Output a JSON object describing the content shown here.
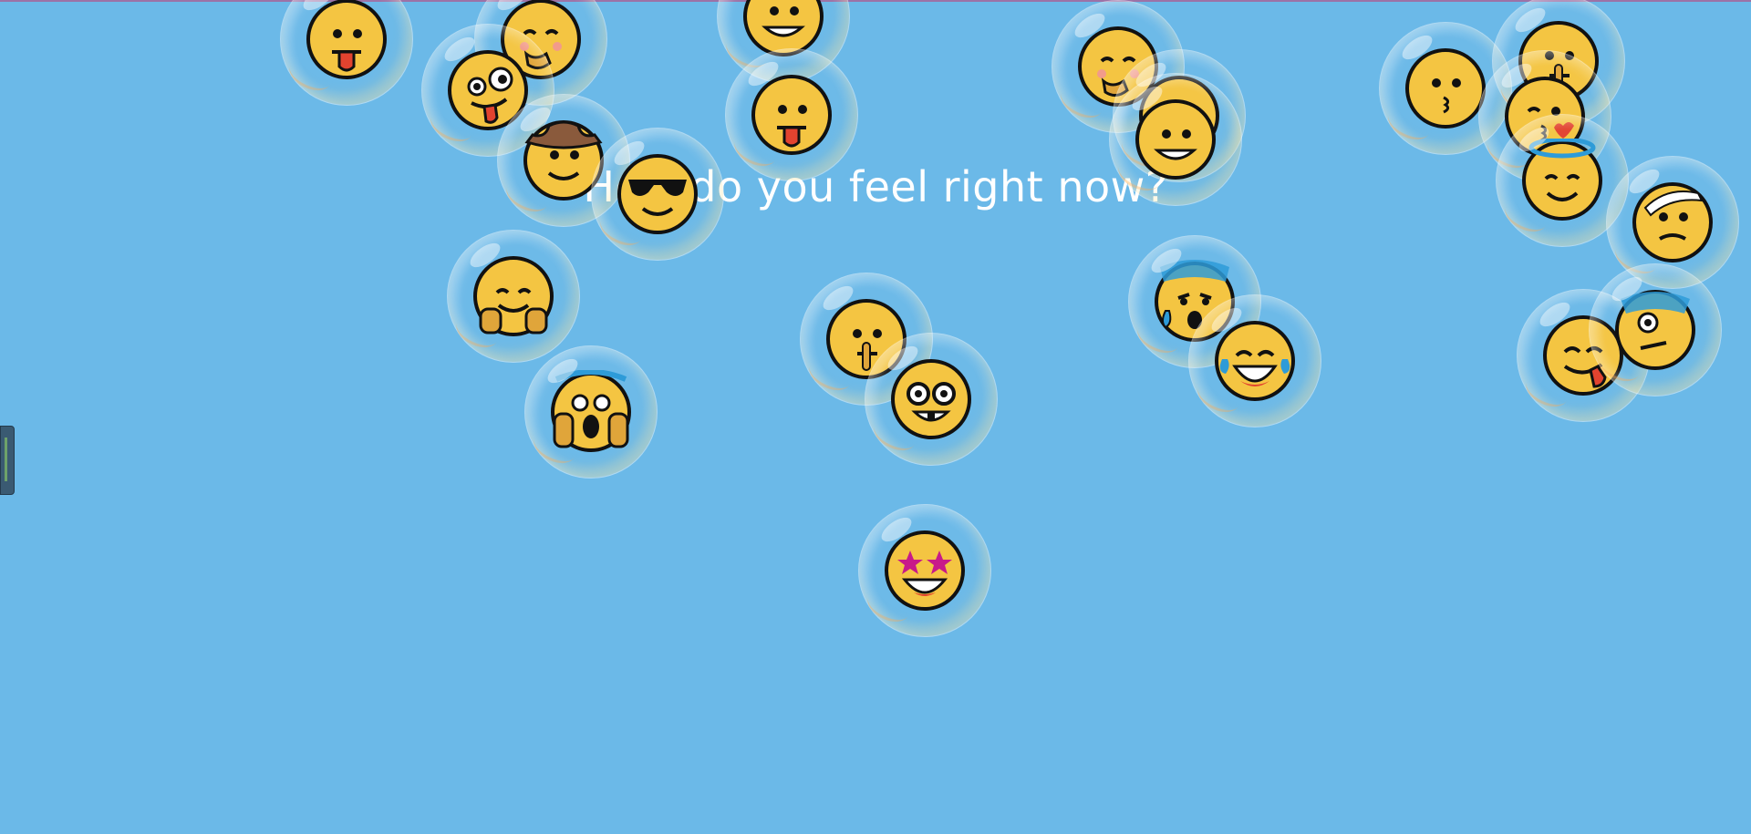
{
  "prompt": {
    "text": "How do you feel right now?"
  },
  "colors": {
    "background": "#6bb9e8",
    "face": "#f4c542",
    "outline": "#111111",
    "tongue": "#e2432f",
    "tear": "#2e9bd8",
    "star": "#c8198a"
  },
  "emojis": [
    {
      "name": "tongue-face-emoji",
      "kind": "tongue"
    },
    {
      "name": "hand-over-mouth-emoji",
      "kind": "hand"
    },
    {
      "name": "grinning-face-emoji",
      "kind": "grin"
    },
    {
      "name": "zany-face-emoji",
      "kind": "zany"
    },
    {
      "name": "tongue-out-face-emoji",
      "kind": "tongue"
    },
    {
      "name": "cowboy-face-emoji",
      "kind": "cowboy"
    },
    {
      "name": "sunglasses-face-emoji",
      "kind": "sunglasses"
    },
    {
      "name": "giggling-face-emoji",
      "kind": "hand"
    },
    {
      "name": "hushed-face-emoji",
      "kind": "hushed"
    },
    {
      "name": "grimacing-face-emoji",
      "kind": "grin"
    },
    {
      "name": "kissing-face-emoji",
      "kind": "kiss"
    },
    {
      "name": "shushing-face-emoji",
      "kind": "shush"
    },
    {
      "name": "blowing-kiss-emoji",
      "kind": "kissheart"
    },
    {
      "name": "halo-face-emoji",
      "kind": "halo"
    },
    {
      "name": "bandage-face-emoji",
      "kind": "bandage"
    },
    {
      "name": "hugging-face-emoji",
      "kind": "hug"
    },
    {
      "name": "screaming-face-emoji",
      "kind": "scream"
    },
    {
      "name": "thinking-face-emoji",
      "kind": "shush"
    },
    {
      "name": "nerd-face-emoji",
      "kind": "nerd"
    },
    {
      "name": "sweat-face-emoji",
      "kind": "sweat"
    },
    {
      "name": "tears-of-joy-emoji",
      "kind": "joy"
    },
    {
      "name": "savoring-face-emoji",
      "kind": "yum"
    },
    {
      "name": "anxious-face-emoji",
      "kind": "anxious"
    },
    {
      "name": "star-struck-emoji",
      "kind": "star"
    }
  ]
}
